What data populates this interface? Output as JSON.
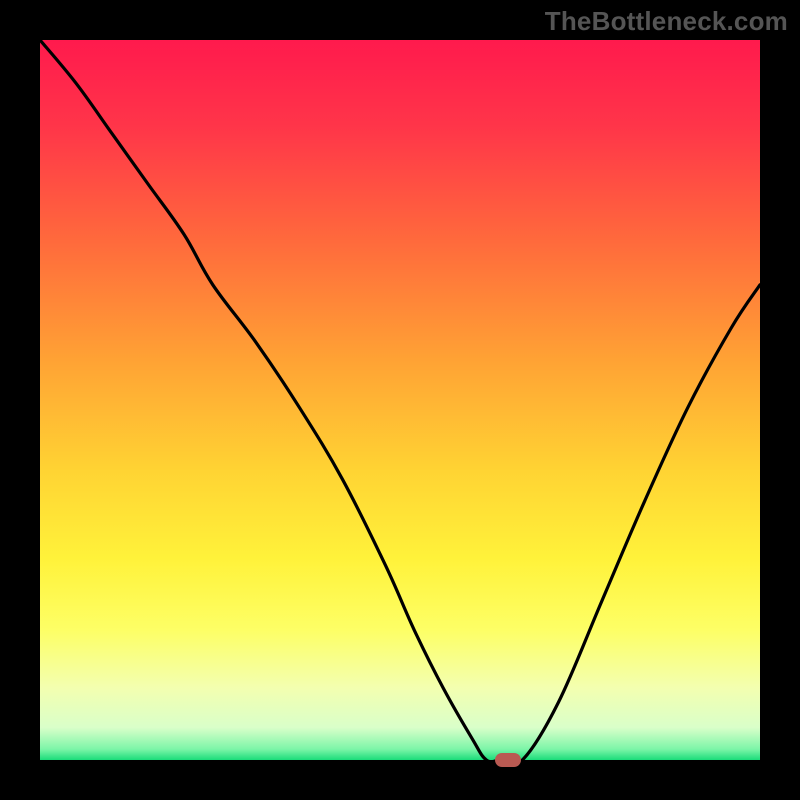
{
  "watermark": "TheBottleneck.com",
  "colors": {
    "background": "#000000",
    "curve_stroke": "#000000",
    "marker_fill": "#b95a52",
    "gradient_stops": [
      {
        "offset": 0.0,
        "color": "#ff1a4d"
      },
      {
        "offset": 0.12,
        "color": "#ff3549"
      },
      {
        "offset": 0.28,
        "color": "#ff6a3c"
      },
      {
        "offset": 0.45,
        "color": "#ffa434"
      },
      {
        "offset": 0.6,
        "color": "#ffd433"
      },
      {
        "offset": 0.72,
        "color": "#fff23a"
      },
      {
        "offset": 0.82,
        "color": "#fdff66"
      },
      {
        "offset": 0.9,
        "color": "#f3ffb0"
      },
      {
        "offset": 0.955,
        "color": "#d9ffc9"
      },
      {
        "offset": 0.985,
        "color": "#7cf5a8"
      },
      {
        "offset": 1.0,
        "color": "#1bdc7a"
      }
    ]
  },
  "chart_data": {
    "type": "line",
    "title": "",
    "xlabel": "",
    "ylabel": "",
    "xlim": [
      0,
      100
    ],
    "ylim": [
      0,
      100
    ],
    "x": [
      0,
      5,
      10,
      15,
      20,
      24,
      30,
      36,
      42,
      48,
      52,
      56,
      60,
      62,
      64,
      67,
      72,
      78,
      84,
      90,
      96,
      100
    ],
    "values": [
      100,
      94,
      87,
      80,
      73,
      66,
      58,
      49,
      39,
      27,
      18,
      10,
      3,
      0,
      0,
      0,
      8,
      22,
      36,
      49,
      60,
      66
    ],
    "marker": {
      "x": 65,
      "y": 0
    },
    "legend": [],
    "annotations": []
  }
}
